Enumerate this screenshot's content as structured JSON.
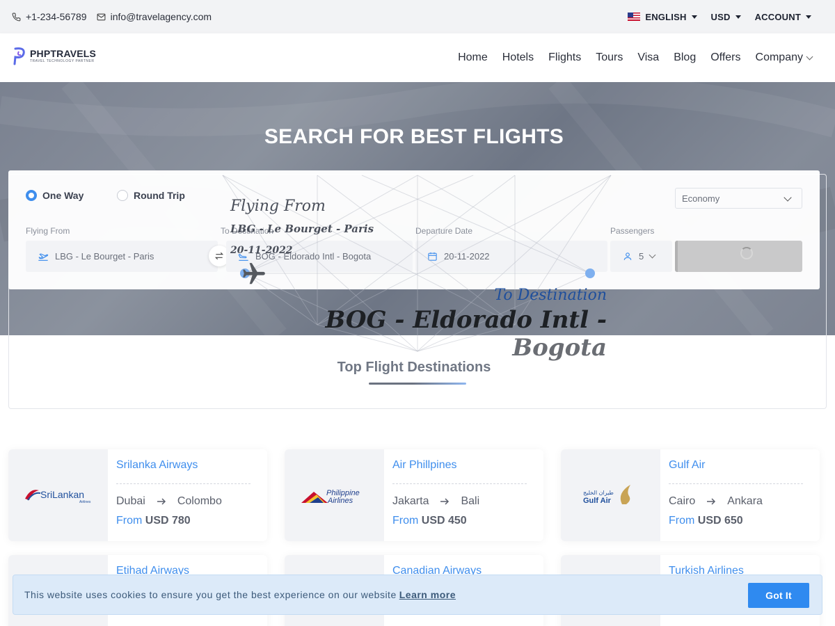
{
  "topbar": {
    "phone": "+1-234-56789",
    "email": "info@travelagency.com",
    "language": "ENGLISH",
    "currency": "USD",
    "account": "ACCOUNT"
  },
  "header": {
    "logo_name": "PHPTRAVELS",
    "logo_tagline": "TRAVEL TECHNOLOGY PARTNER",
    "nav": [
      "Home",
      "Hotels",
      "Flights",
      "Tours",
      "Visa",
      "Blog",
      "Offers",
      "Company"
    ]
  },
  "hero": {
    "title": "SEARCH FOR BEST FLIGHTS"
  },
  "search": {
    "trip_types": [
      "One Way",
      "Round Trip"
    ],
    "selected_trip": "One Way",
    "cabin_class": "Economy",
    "labels": {
      "from": "Flying From",
      "to": "To Destination",
      "date": "Departure Date",
      "passengers": "Passengers"
    },
    "values": {
      "from": "LBG - Le Bourget - Paris",
      "to": "BOG - Eldorado Intl - Bogota",
      "date": "20-11-2022",
      "passengers": "5"
    }
  },
  "animation": {
    "from_heading": "Flying From",
    "from_value": "LBG - Le Bourget - Paris",
    "date": "20-11-2022",
    "to_heading": "To Destination",
    "to_code": "BOG - Eldorado Intl -",
    "to_city": "Bogota"
  },
  "destinations": {
    "title": "Top Flight Destinations",
    "price_prefix": "From",
    "cards": [
      {
        "airline": "Srilanka Airways",
        "from": "Dubai",
        "to": "Colombo",
        "price": "USD 780",
        "logo_text": "SriLankan",
        "logo_sub": "Airlines"
      },
      {
        "airline": "Air Phillpines",
        "from": "Jakarta",
        "to": "Bali",
        "price": "USD 450",
        "logo_text": "Philippine",
        "logo_sub": "Airlines"
      },
      {
        "airline": "Gulf Air",
        "from": "Cairo",
        "to": "Ankara",
        "price": "USD 650",
        "logo_text": "Gulf Air",
        "logo_sub": "طيران الخليج"
      }
    ],
    "cards_row2": [
      {
        "airline": "Etihad Airways"
      },
      {
        "airline": "Canadian Airways"
      },
      {
        "airline": "Turkish Airlines"
      }
    ]
  },
  "cookie": {
    "message": "This website uses cookies to ensure you get the best experience on our website",
    "link": "Learn more",
    "button": "Got It"
  }
}
